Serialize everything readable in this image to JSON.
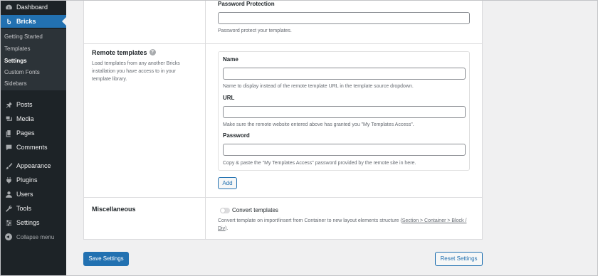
{
  "sidebar": {
    "dashboard": "Dashboard",
    "bricks": "Bricks",
    "submenu": [
      "Getting Started",
      "Templates",
      "Settings",
      "Custom Fonts",
      "Sidebars"
    ],
    "posts": "Posts",
    "media": "Media",
    "pages": "Pages",
    "comments": "Comments",
    "appearance": "Appearance",
    "plugins": "Plugins",
    "users": "Users",
    "tools": "Tools",
    "settings": "Settings",
    "collapse": "Collapse menu"
  },
  "password_protection": {
    "label": "Password Protection",
    "value": "",
    "description": "Password protect your templates."
  },
  "remote_templates": {
    "title": "Remote templates",
    "help": "?",
    "description": "Load templates from any another Bricks installation you have access to in your template library.",
    "name_label": "Name",
    "name_value": "",
    "name_desc": "Name to display instead of the remote template URL in the template source dropdown.",
    "url_label": "URL",
    "url_value": "",
    "url_desc": "Make sure the remote website entered above has granted you \"My Templates Access\".",
    "password_label": "Password",
    "password_value": "",
    "password_desc": "Copy & paste the \"My Templates Access\" password provided by the remote site in here.",
    "add_button": "Add"
  },
  "miscellaneous": {
    "title": "Miscellaneous",
    "toggle_label": "Convert templates",
    "toggle_on": false,
    "desc_prefix": "Convert template on import/insert from Container to new layout elements structure (",
    "desc_link": "Section > Container > Block / Div",
    "desc_suffix": ")."
  },
  "footer": {
    "save": "Save Settings",
    "reset": "Reset Settings"
  },
  "colors": {
    "sidebar_bg": "#1d2327",
    "submenu_bg": "#2c3338",
    "accent": "#2271b1",
    "page_bg": "#f0f0f1"
  }
}
